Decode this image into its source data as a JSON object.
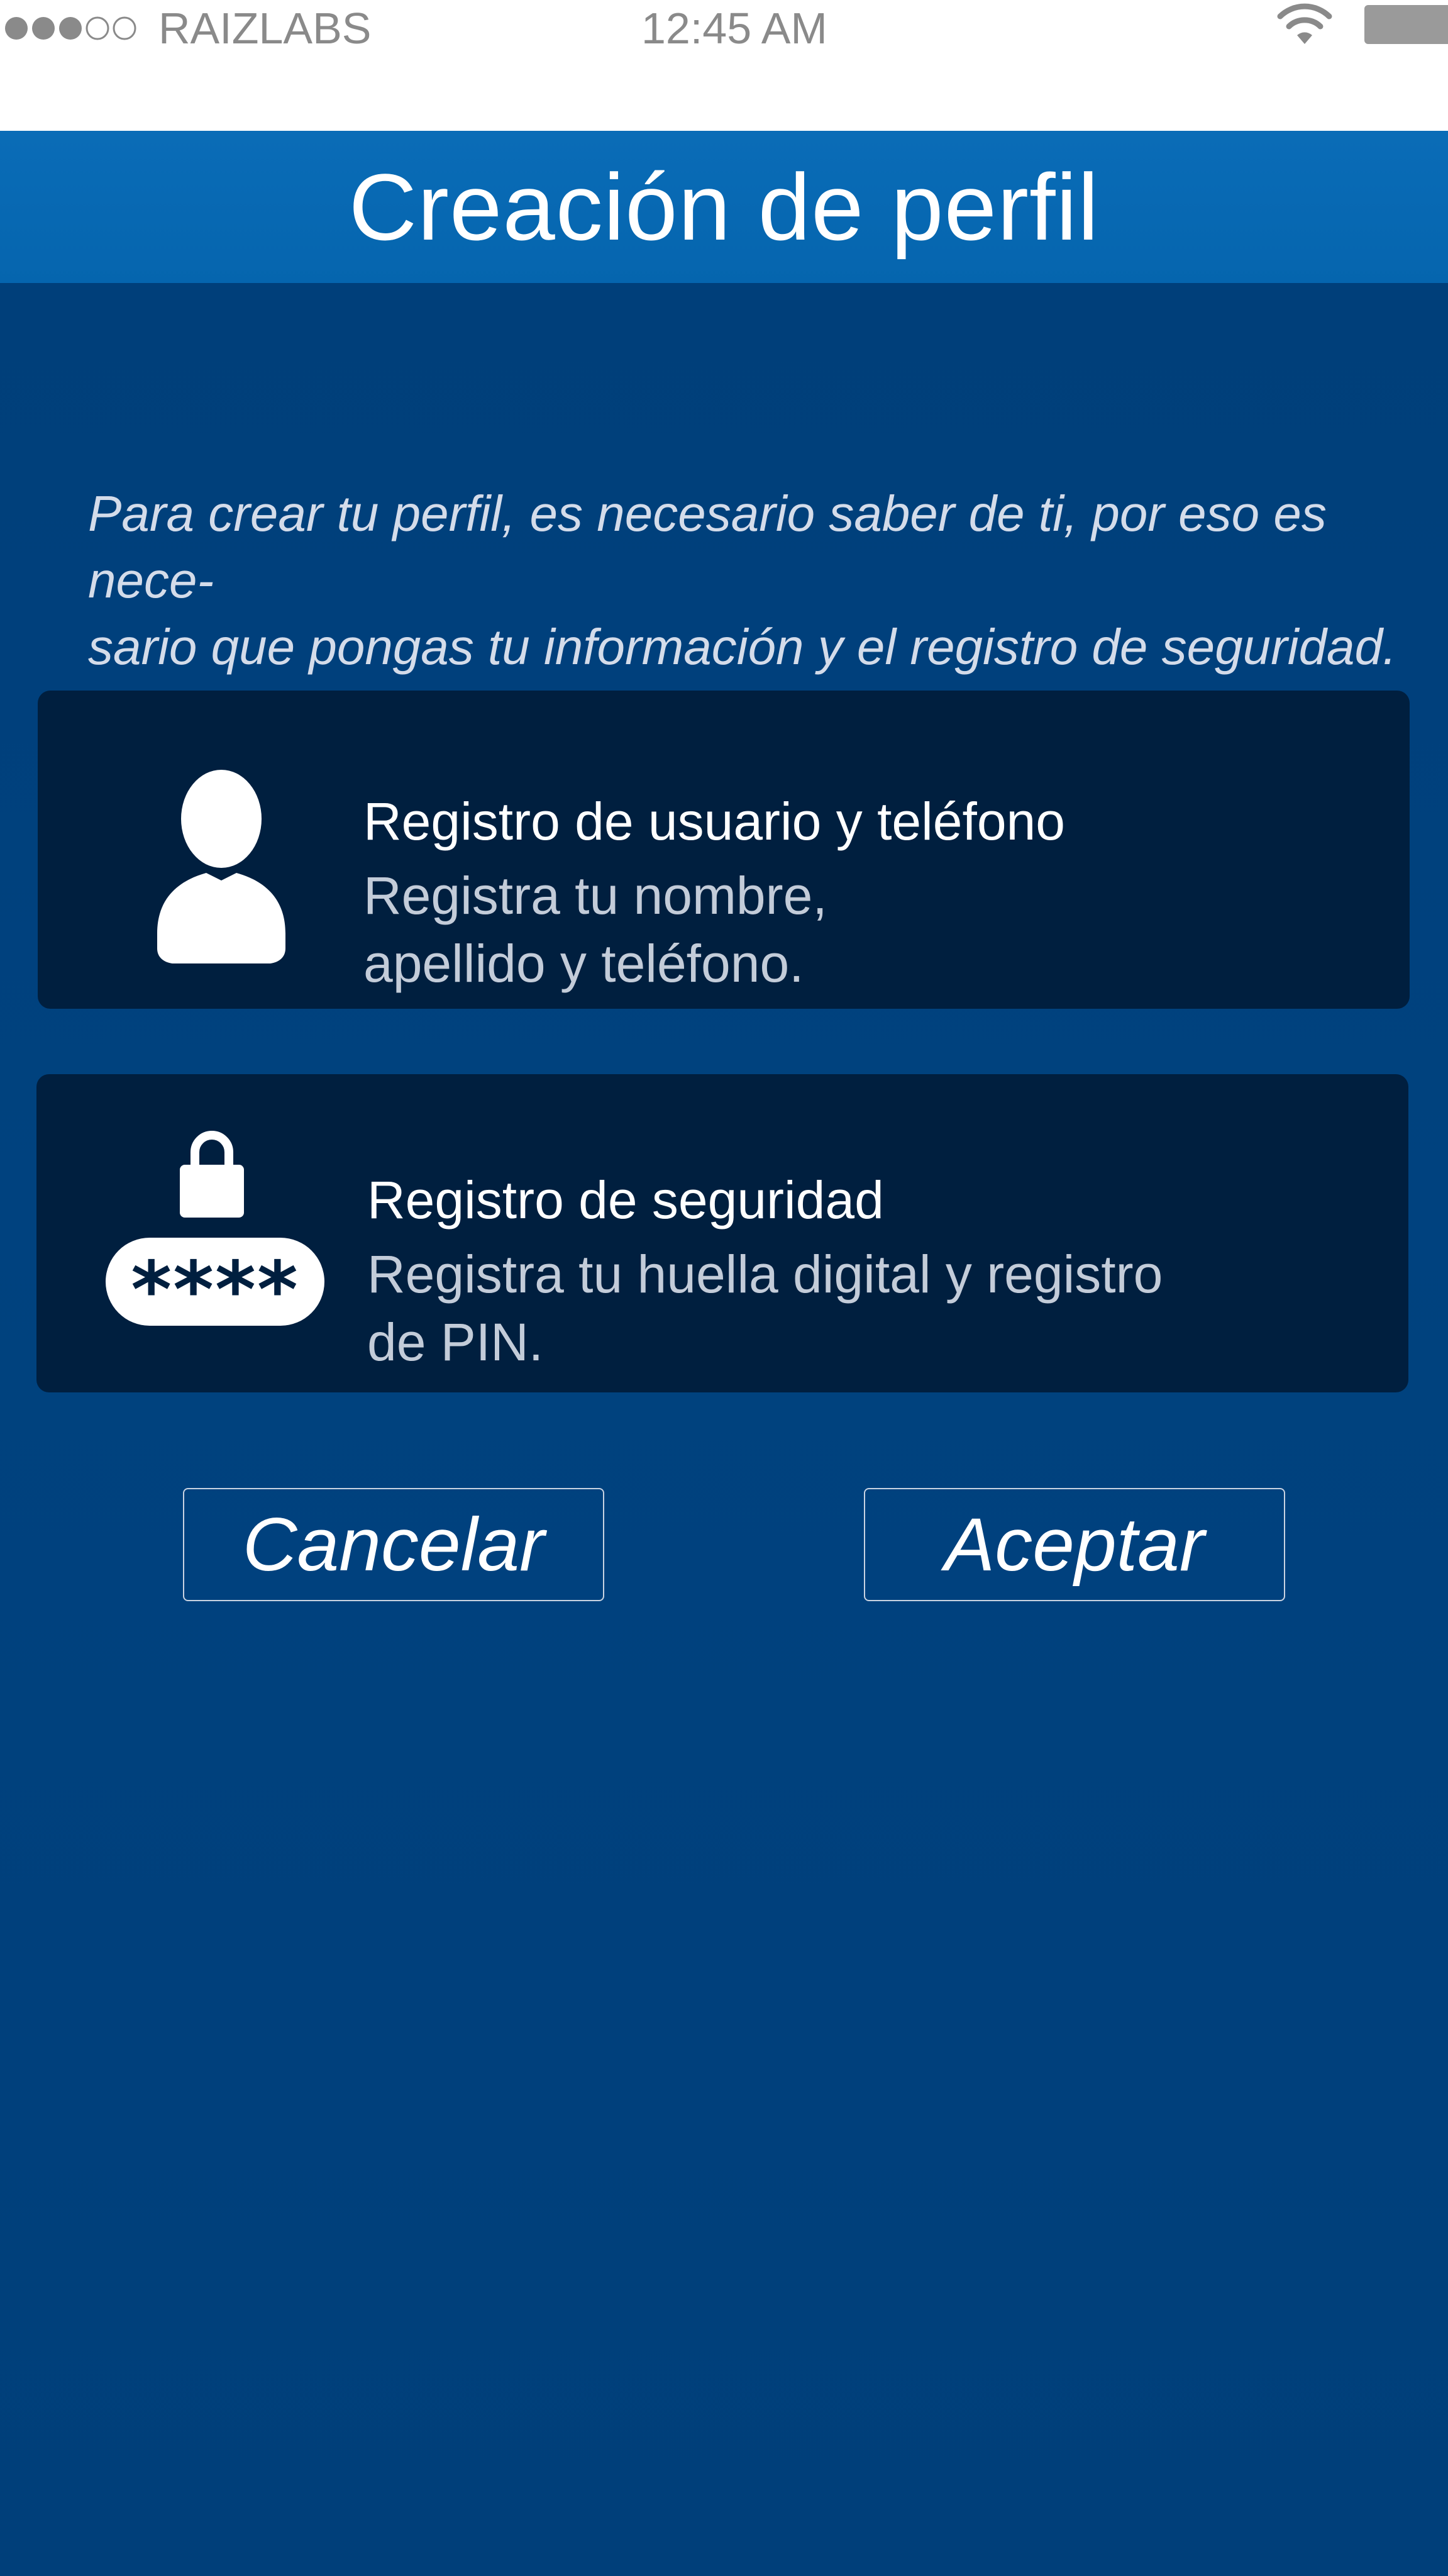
{
  "status_bar": {
    "signal_icon": "signal-dots-icon",
    "carrier": "RAIZLABS",
    "time": "12:45 AM",
    "wifi_icon": "wifi-icon",
    "battery_icon": "battery-icon"
  },
  "header": {
    "title": "Creación de perfil"
  },
  "main": {
    "intro": "Para crear tu perfil, es necesario saber de ti, por eso es nece-\nsario que pongas tu información y  el registro de seguridad.",
    "cards": [
      {
        "icon": "user-icon",
        "title": "Registro de usuario y teléfono",
        "description": "Registra tu nombre,\napellido y teléfono."
      },
      {
        "icon": "lock-icon",
        "pin_mask": "****",
        "title": "Registro de seguridad",
        "description": "Registra tu huella digital y registro\nde PIN."
      }
    ],
    "buttons": {
      "cancel": "Cancelar",
      "accept": "Aceptar"
    }
  },
  "colors": {
    "background": "#01407c",
    "title_bar": "#0a6cb7",
    "card": "#001f3f",
    "status_text": "#8a8a8a"
  }
}
